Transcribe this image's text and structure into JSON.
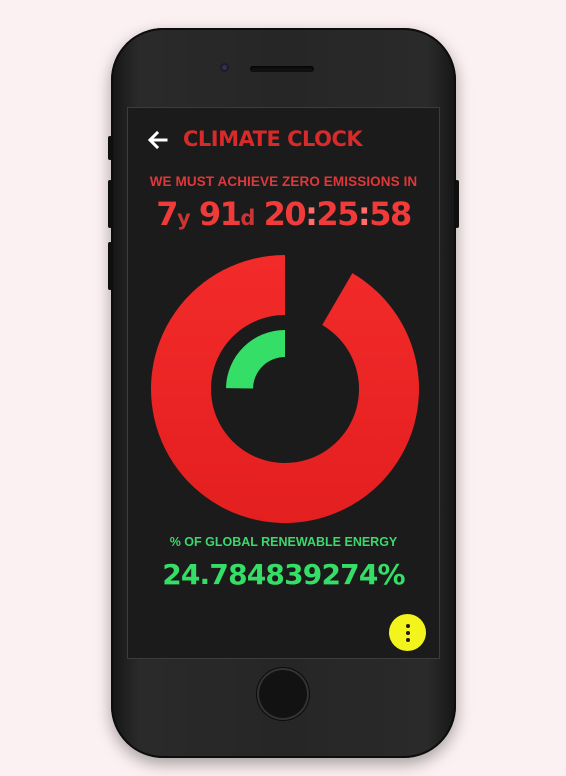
{
  "app": {
    "title": "CLIMATE CLOCK",
    "back_icon": "arrow-left-icon",
    "menu_icon": "more-vertical-icon"
  },
  "deadline": {
    "label": "WE MUST ACHIEVE ZERO EMISSIONS IN",
    "years": "7",
    "years_unit": "y",
    "days": "91",
    "days_unit": "d",
    "hours": "20",
    "minutes": "25",
    "seconds": "58"
  },
  "renewable": {
    "label": "% OF GLOBAL RENEWABLE ENERGY",
    "value": "24.784839274%",
    "percent": 24.784839274
  },
  "gauge": {
    "outer_ring_fraction": 0.93,
    "inner_arc_fraction": 0.2478
  },
  "colors": {
    "background": "#fcf1f2",
    "screen": "#1b1b1b",
    "title_red": "#d72a2a",
    "countdown_red": "#f13a3a",
    "ring_red": "#f22a2a",
    "energy_green": "#35de66",
    "menu_yellow": "#f3f41c"
  }
}
